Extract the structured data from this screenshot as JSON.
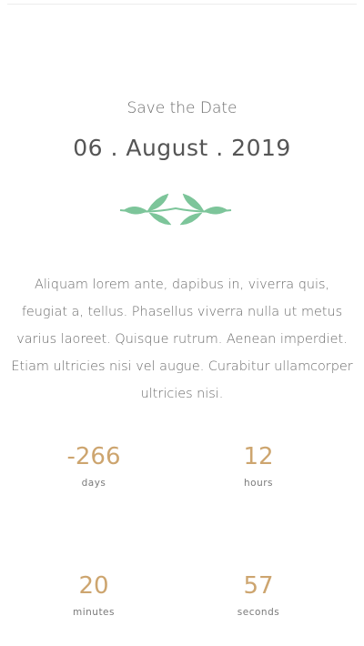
{
  "header": {
    "kicker": "Save the Date",
    "date": "06 . August . 2019"
  },
  "ornament": {
    "icon": "leaf-branch-icon",
    "color": "#7dc59a"
  },
  "body_text": "Aliquam lorem ante, dapibus in, viverra quis, feugiat a, tellus. Phasellus viverra nulla ut metus varius laoreet. Quisque rutrum. Aenean imperdiet. Etiam ultricies nisi vel augue. Curabitur ullamcorper ultricies nisi.",
  "countdown": {
    "days": {
      "value": "-266",
      "label": "days"
    },
    "hours": {
      "value": "12",
      "label": "hours"
    },
    "minutes": {
      "value": "20",
      "label": "minutes"
    },
    "seconds": {
      "value": "57",
      "label": "seconds"
    }
  },
  "colors": {
    "accent_gold": "#cda56f",
    "accent_green": "#7dc59a",
    "text_gray": "#6b6b6b"
  }
}
